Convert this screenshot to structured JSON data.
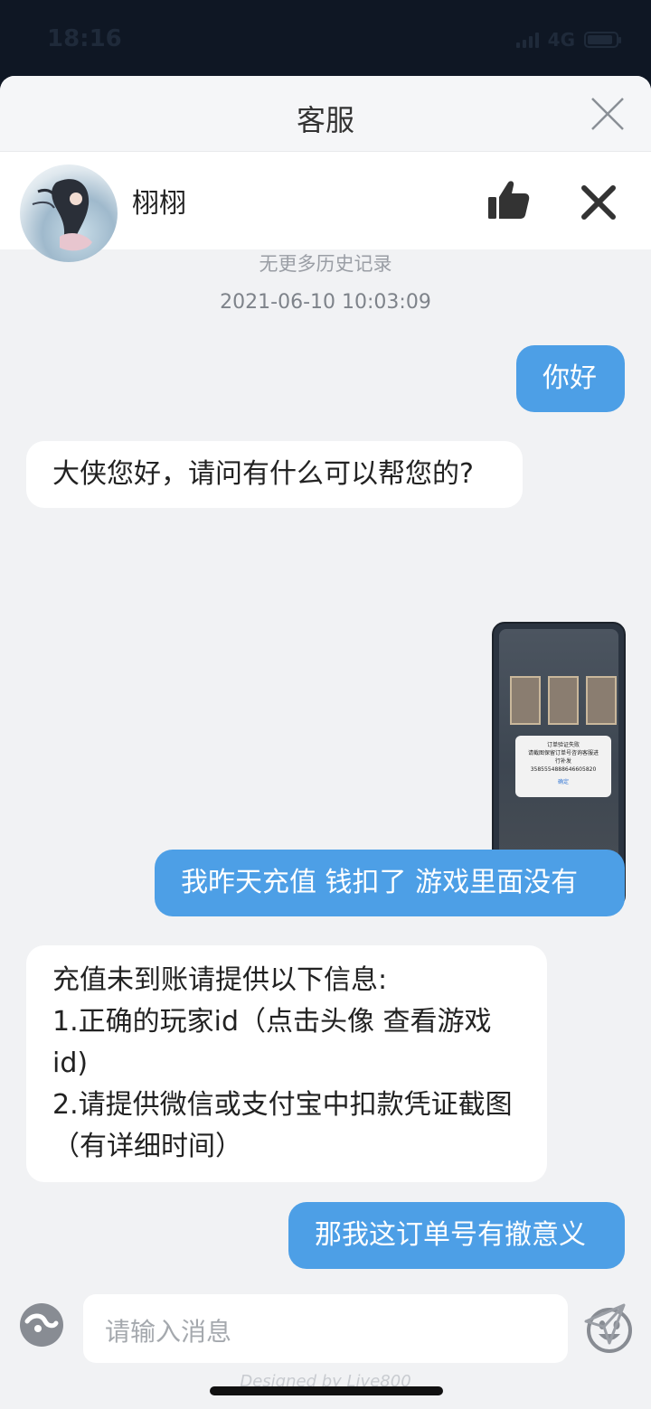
{
  "status": {
    "time": "18:16",
    "network": "4G"
  },
  "header": {
    "title": "客服"
  },
  "agent": {
    "name": "栩栩"
  },
  "chat": {
    "history_notice": "无更多历史记录",
    "timestamp": "2021-06-10 10:03:09",
    "messages": [
      {
        "from": "me",
        "text": "你好"
      },
      {
        "from": "them",
        "text": "大侠您好，请问有什么可以帮您的?"
      },
      {
        "from": "me",
        "type": "image"
      },
      {
        "from": "me",
        "text": "我昨天充值  钱扣了 游戏里面没有"
      },
      {
        "from": "them",
        "lines": [
          "充值未到账请提供以下信息:",
          "1.正确的玩家id（点击头像 查看游戏",
          "id)",
          "2.请提供微信或支付宝中扣款凭证截图",
          "（有详细时间）"
        ]
      },
      {
        "from": "me",
        "text": "那我这订单号有撤意义"
      }
    ],
    "screenshot_dialog": {
      "line1": "订单验证失败",
      "line2": "请截图保留订单号咨询客服进",
      "line3": "行补发",
      "line4": "3585554888646605820",
      "button": "确定"
    }
  },
  "input": {
    "placeholder": "请输入消息"
  },
  "footer": {
    "powered_by": "Designed by Live800"
  },
  "colors": {
    "accent": "#4d9fe6",
    "background": "#f1f2f4"
  }
}
